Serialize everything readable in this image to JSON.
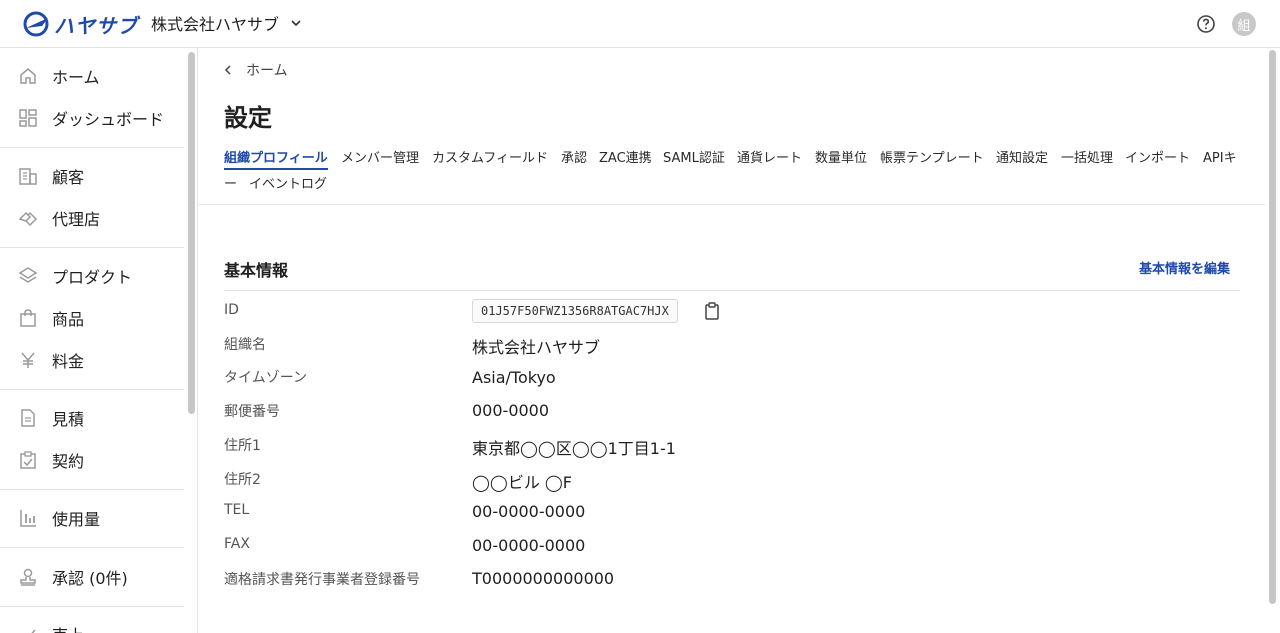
{
  "header": {
    "logo_text": "ハヤサブ",
    "org_name": "株式会社ハヤサブ",
    "avatar_text": "組"
  },
  "sidebar": {
    "items": [
      {
        "label": "ホーム",
        "icon": "home-icon"
      },
      {
        "label": "ダッシュボード",
        "icon": "dashboard-icon"
      },
      {
        "label": "顧客",
        "icon": "customer-icon"
      },
      {
        "label": "代理店",
        "icon": "agency-icon"
      },
      {
        "label": "プロダクト",
        "icon": "product-icon"
      },
      {
        "label": "商品",
        "icon": "item-icon"
      },
      {
        "label": "料金",
        "icon": "yen-icon"
      },
      {
        "label": "見積",
        "icon": "quote-icon"
      },
      {
        "label": "契約",
        "icon": "contract-icon"
      },
      {
        "label": "使用量",
        "icon": "usage-icon"
      },
      {
        "label": "承認 (0件)",
        "icon": "approval-icon"
      },
      {
        "label": "売上",
        "icon": "sales-icon"
      }
    ]
  },
  "breadcrumb": {
    "label": "ホーム"
  },
  "page": {
    "title": "設定"
  },
  "tabs": [
    "組織プロフィール",
    "メンバー管理",
    "カスタムフィールド",
    "承認",
    "ZAC連携",
    "SAML認証",
    "通貨レート",
    "数量単位",
    "帳票テンプレート",
    "通知設定",
    "一括処理",
    "インポート",
    "APIキ",
    "ー",
    "イベントログ"
  ],
  "section": {
    "title": "基本情報",
    "edit_label": "基本情報を編集"
  },
  "fields": [
    {
      "label": "ID",
      "value": "01J57F50FWZ1356R8ATGAC7HJX"
    },
    {
      "label": "組織名",
      "value": "株式会社ハヤサブ"
    },
    {
      "label": "タイムゾーン",
      "value": "Asia/Tokyo"
    },
    {
      "label": "郵便番号",
      "value": "000-0000"
    },
    {
      "label": "住所1",
      "value": "東京都◯◯区◯◯1丁目1-1"
    },
    {
      "label": "住所2",
      "value": "◯◯ビル ◯F"
    },
    {
      "label": "TEL",
      "value": "00-0000-0000"
    },
    {
      "label": "FAX",
      "value": "00-0000-0000"
    },
    {
      "label": "適格請求書発行事業者登録番号",
      "value": "T0000000000000"
    }
  ],
  "colors": {
    "accent": "#1f4aa8",
    "border": "#e4e4e4"
  }
}
